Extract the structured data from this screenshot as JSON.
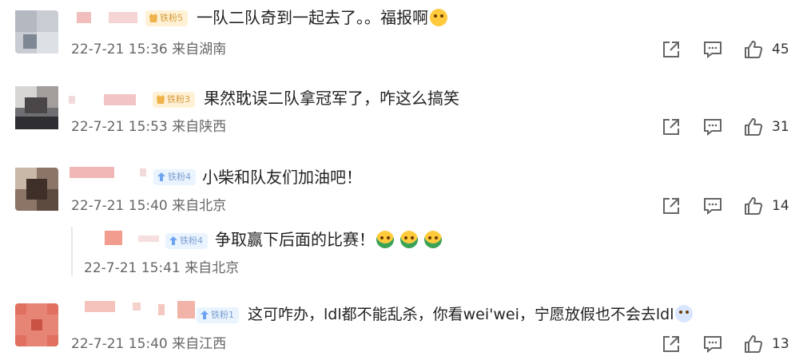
{
  "comments": [
    {
      "badge": "铁粉5",
      "text": "一队二队奇到一起去了。。福报啊",
      "time": "22-7-21 15:36",
      "location": "来自湖南",
      "likes": "45"
    },
    {
      "badge": "铁粉3",
      "text": "果然耽误二队拿冠军了，咋这么搞笑",
      "time": "22-7-21 15:53",
      "location": "来自陕西",
      "likes": "31"
    },
    {
      "badge": "铁粉4",
      "text": "小柴和队友们加油吧！",
      "time": "22-7-21 15:40",
      "location": "来自北京",
      "likes": "14"
    },
    {
      "badge": "铁粉4",
      "text": "争取赢下后面的比赛！",
      "time": "22-7-21 15:41",
      "location": "来自北京"
    },
    {
      "badge": "铁粉1",
      "text": "这可咋办，ldl都不能乱杀，你看wei'wei，宁愿放假也不会去ldl",
      "time": "22-7-21 15:40",
      "location": "来自江西",
      "likes": "13"
    }
  ],
  "icons": {
    "share": "share-icon",
    "comment": "comment-icon",
    "like": "thumbs-up-icon",
    "badge": "fan-badge-icon"
  },
  "colors": {
    "badge_blue_bg": "#eaf4ff",
    "badge_gold_bg": "#fff1d6",
    "meta_text": "#666666"
  }
}
